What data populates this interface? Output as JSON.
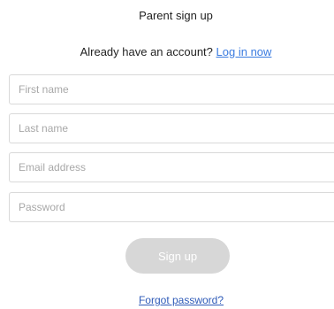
{
  "header": {
    "title": "Parent sign up",
    "login_prompt": "Already have an account?",
    "login_link": "Log in now"
  },
  "form": {
    "first_name": {
      "placeholder": "First name",
      "value": ""
    },
    "last_name": {
      "placeholder": "Last name",
      "value": ""
    },
    "email": {
      "placeholder": "Email address",
      "value": ""
    },
    "password": {
      "placeholder": "Password",
      "value": ""
    },
    "submit_label": "Sign up"
  },
  "footer": {
    "forgot_password": "Forgot password?"
  },
  "colors": {
    "link": "#3a7be0",
    "button_disabled": "#d7d7d7",
    "input_border": "#d9d9d9"
  }
}
